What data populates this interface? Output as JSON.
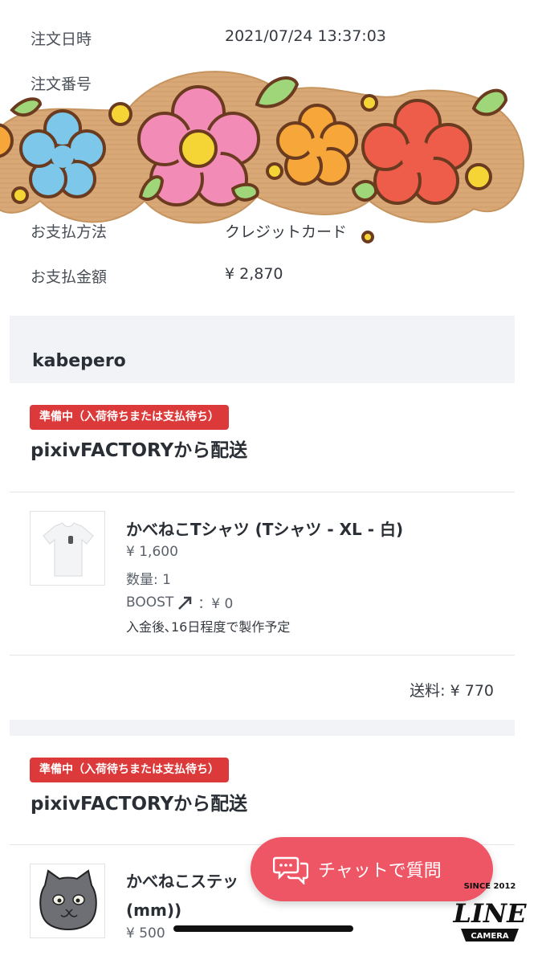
{
  "order_info": {
    "date_label": "注文日時",
    "date_value": "2021/07/24 13:37:03",
    "number_label": "注文番号",
    "payment_method_label": "お支払方法",
    "payment_method_value": "クレジットカード",
    "payment_amount_label": "お支払金額",
    "payment_amount_value": "¥ 2,870"
  },
  "shop": {
    "name": "kabepero"
  },
  "shipments": [
    {
      "status_badge": "準備中（入荷待ちまたは支払待ち）",
      "title": "pixivFACTORYから配送",
      "item": {
        "name": "かべねこTシャツ (Tシャツ - XL - 白)",
        "price": "¥ 1,600",
        "quantity": "数量: 1",
        "boost_label": "BOOST",
        "boost_value": "：¥ 0",
        "note": "入金後､16日程度で製作予定",
        "thumb_icon": "t-shirt-icon"
      },
      "shipping_fee": "送料: ¥ 770"
    },
    {
      "status_badge": "準備中（入荷待ちまたは支払待ち）",
      "title": "pixivFACTORYから配送",
      "item": {
        "name_line1": "かべねこステッ",
        "name_line2": "(mm))",
        "price": "¥ 500",
        "thumb_icon": "cat-sticker-icon"
      }
    }
  ],
  "chat_button": {
    "label": "チャットで質問",
    "icon": "chat-bubble-icon"
  },
  "watermark": {
    "brand": "LINE",
    "since": "SINCE 2012",
    "sub": "CAMERA"
  },
  "colors": {
    "badge": "#dc3a3a",
    "chat_button": "#ef5665",
    "band": "#f1f3f6"
  }
}
